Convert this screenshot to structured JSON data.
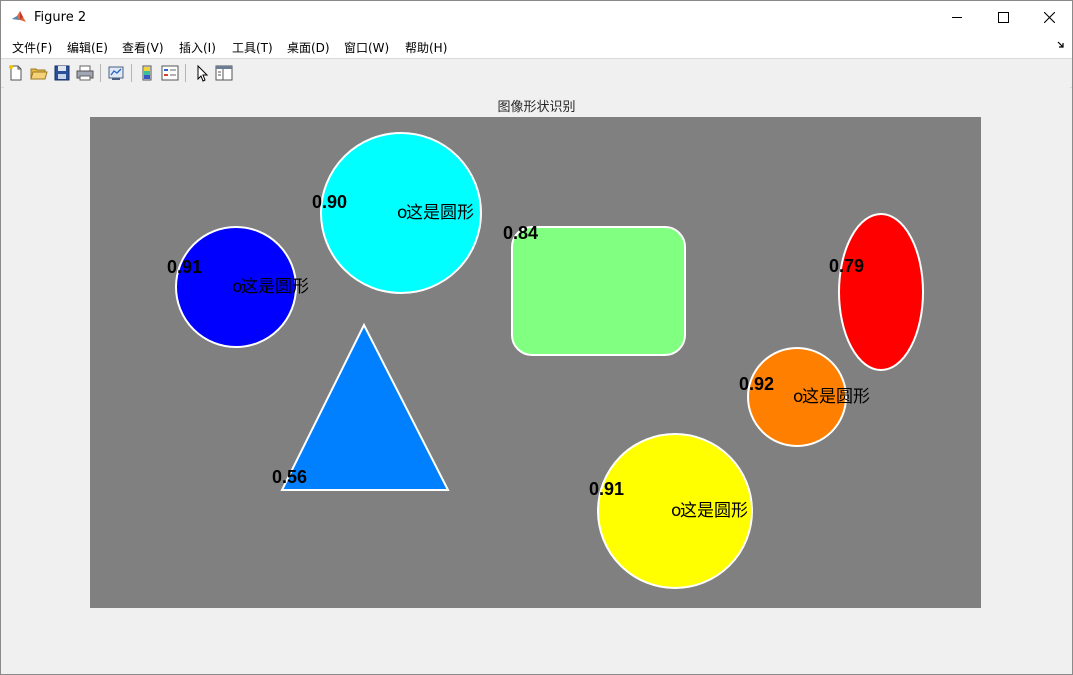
{
  "window": {
    "title": "Figure 2",
    "icon": "matlab-icon"
  },
  "menu": {
    "items": [
      "文件(F)",
      "编辑(E)",
      "查看(V)",
      "插入(I)",
      "工具(T)",
      "桌面(D)",
      "窗口(W)",
      "帮助(H)"
    ]
  },
  "toolbar": {
    "icons": [
      "new-figure-icon",
      "open-file-icon",
      "save-icon",
      "print-icon",
      "link-plot-icon",
      "insert-colorbar-icon",
      "insert-legend-icon",
      "edit-plot-icon",
      "property-inspector-icon"
    ]
  },
  "figure": {
    "title": "图像形状识别",
    "background": "#808080",
    "shapes": [
      {
        "kind": "circle",
        "color": "#00ffff",
        "score": "0.90",
        "label": "这是圆形",
        "marker": "o"
      },
      {
        "kind": "circle",
        "color": "#0000ff",
        "score": "0.91",
        "label": "这是圆形",
        "marker": "o"
      },
      {
        "kind": "rounded-rectangle",
        "color": "#80ff80",
        "score": "0.84"
      },
      {
        "kind": "ellipse",
        "color": "#ff0000",
        "score": "0.79"
      },
      {
        "kind": "triangle",
        "color": "#0080ff",
        "score": "0.56"
      },
      {
        "kind": "circle",
        "color": "#ff8000",
        "score": "0.92",
        "label": "这是圆形",
        "marker": "o"
      },
      {
        "kind": "circle",
        "color": "#ffff00",
        "score": "0.91",
        "label": "这是圆形",
        "marker": "o"
      }
    ]
  }
}
